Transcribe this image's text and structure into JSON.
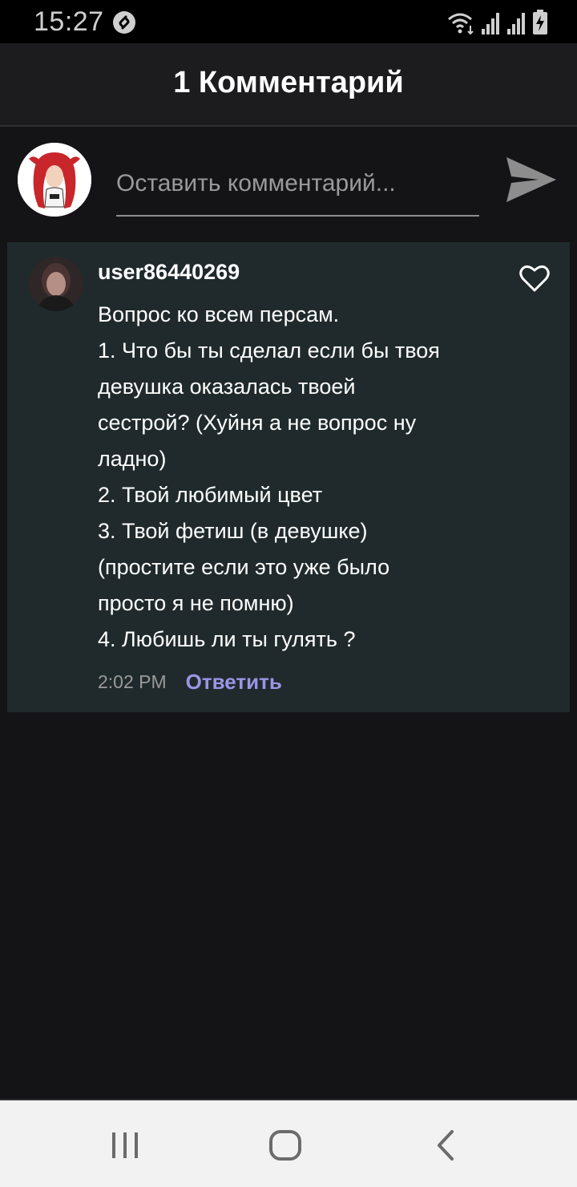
{
  "status_bar": {
    "time": "15:27",
    "app_icon": "shazam-icon",
    "wifi_icon": "wifi-icon",
    "signal_icons": [
      "signal-icon",
      "signal-icon"
    ],
    "battery_icon": "battery-charging-icon"
  },
  "header": {
    "title": "1 Комментарий"
  },
  "compose": {
    "placeholder": "Оставить комментарий...",
    "value": "",
    "send_icon": "send-icon"
  },
  "comment": {
    "username": "user86440269",
    "lines": [
      "Вопрос ко всем персам.",
      "1. Что бы ты сделал если бы твоя",
      "девушка оказалась твоей",
      "сестрой? (Хуйня а не вопрос ну",
      "ладно)",
      "2. Твой любимый цвет",
      "3. Твой фетиш (в девушке)",
      "(простите если это уже было",
      "просто я не помню)",
      "4. Любишь ли ты гулять ?"
    ],
    "time": "2:02 PM",
    "reply_label": "Ответить",
    "like_icon": "heart-outline-icon"
  },
  "nav": {
    "recents_icon": "recents-icon",
    "home_icon": "home-icon",
    "back_icon": "back-icon"
  },
  "colors": {
    "background": "#141316",
    "header": "#1c1b1e",
    "card": "#202a2c",
    "reply_accent": "#9b95e6",
    "nav_bar": "#f2f2f2"
  }
}
